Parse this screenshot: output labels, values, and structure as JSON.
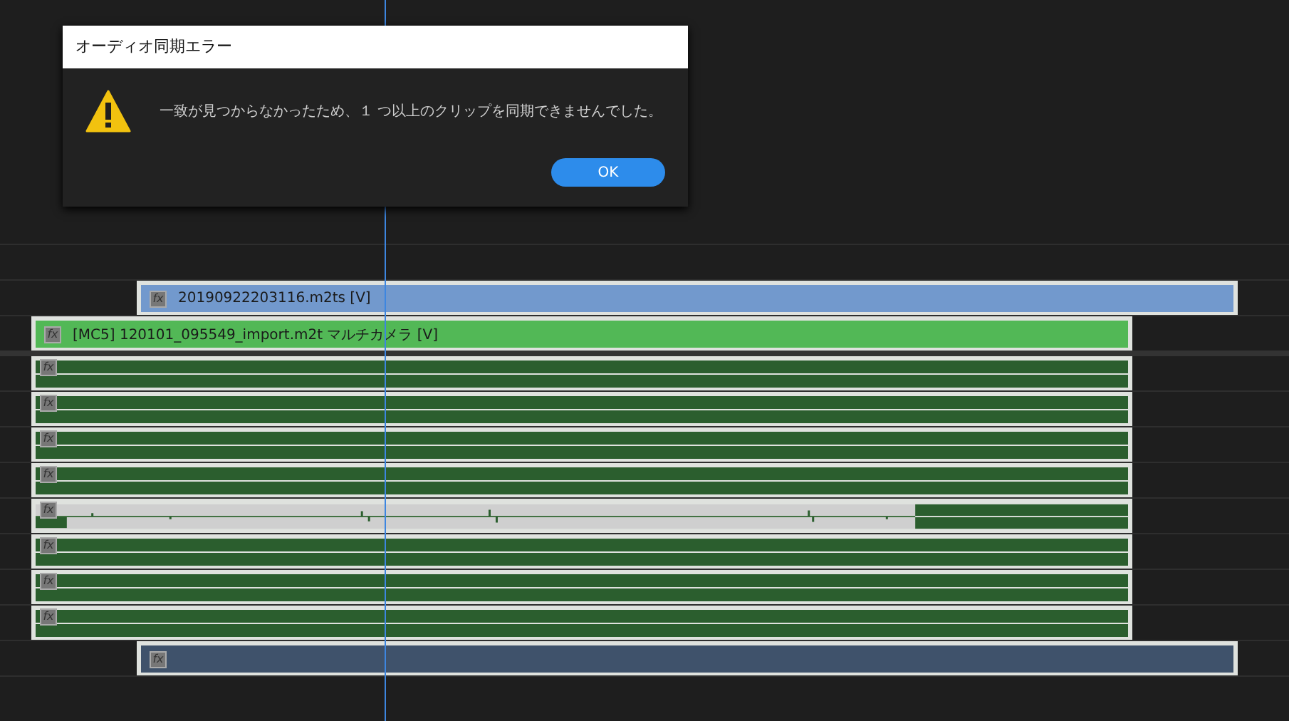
{
  "dialog": {
    "title": "オーディオ同期エラー",
    "message": "一致が見つからなかったため、１ つ以上のクリップを同期できませんでした。",
    "buttons": [
      "OK"
    ]
  },
  "tracks": [
    {
      "clips": [
        {
          "kind": "video",
          "badge": "fx",
          "label": "20190922203116.m2ts [V]"
        }
      ]
    },
    {
      "clips": [
        {
          "kind": "multicam",
          "badge": "fx",
          "label": "[MC5]  120101_095549_import.m2t  マルチカメラ  [V]"
        }
      ]
    },
    {
      "clips": [
        {
          "kind": "audio",
          "badge": "fx"
        }
      ]
    },
    {
      "clips": [
        {
          "kind": "audio",
          "badge": "fx"
        }
      ]
    },
    {
      "clips": [
        {
          "kind": "audio",
          "badge": "fx"
        }
      ]
    },
    {
      "clips": [
        {
          "kind": "audio",
          "badge": "fx"
        }
      ]
    },
    {
      "clips": [
        {
          "kind": "audio-wave",
          "badge": "fx"
        }
      ]
    },
    {
      "clips": [
        {
          "kind": "audio",
          "badge": "fx"
        }
      ]
    },
    {
      "clips": [
        {
          "kind": "audio",
          "badge": "fx"
        }
      ]
    },
    {
      "clips": [
        {
          "kind": "audio",
          "badge": "fx"
        }
      ]
    },
    {
      "clips": [
        {
          "kind": "video-dark",
          "badge": "fx"
        }
      ]
    }
  ]
}
